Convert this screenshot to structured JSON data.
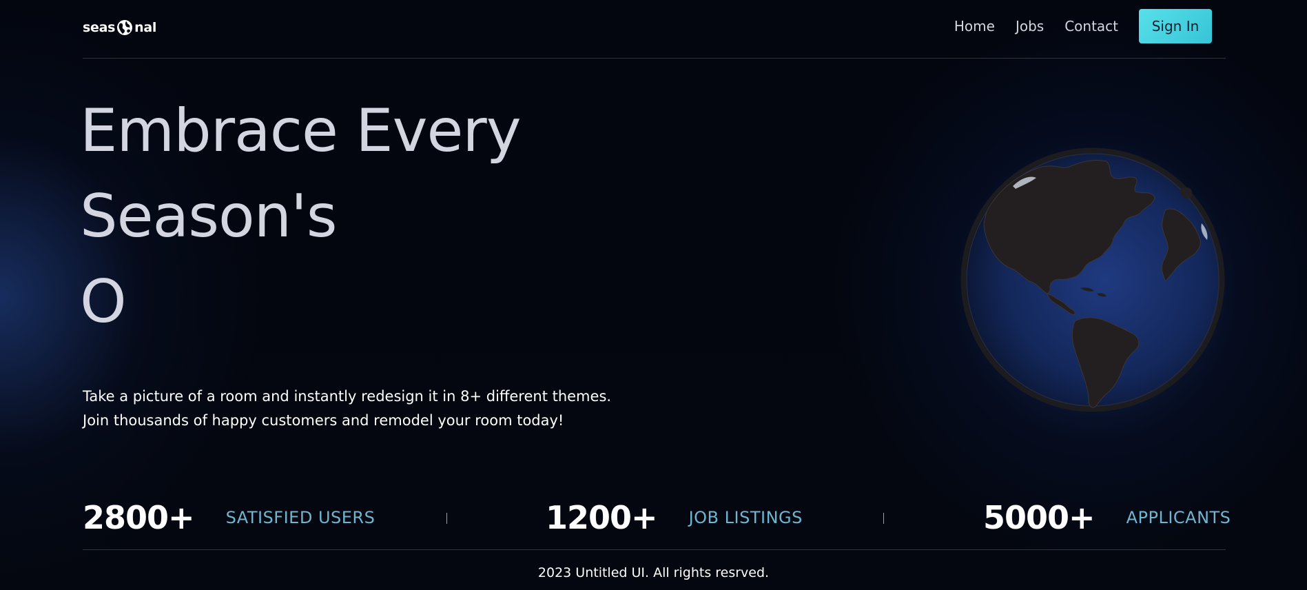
{
  "header": {
    "logo": {
      "text_before": "seas",
      "icon": "globe-icon",
      "text_after": "nal"
    },
    "nav": {
      "items": [
        "Home",
        "Jobs",
        "Contact"
      ],
      "signin_label": "Sign In"
    }
  },
  "hero": {
    "title_lines": [
      "Embrace Every",
      "Season's",
      "O"
    ],
    "description_lines": [
      "Take a picture of a room and instantly redesign it in 8+ different themes.",
      "Join thousands of happy customers and remodel your room today!"
    ],
    "illustration": "earth-globe-icon"
  },
  "stats": [
    {
      "value": "2800+",
      "label": "SATISFIED USERS"
    },
    {
      "value": "1200+",
      "label": "JOB LISTINGS"
    },
    {
      "value": "5000+",
      "label": "APPLICANTS"
    }
  ],
  "footer": {
    "text": "2023 Untitled UI. All rights resrved."
  },
  "colors": {
    "background": "#03060f",
    "glow": "#1e3a78",
    "accent": "#48d2e0",
    "stat_label": "#6fb6d0",
    "title": "#d3d6e0"
  }
}
